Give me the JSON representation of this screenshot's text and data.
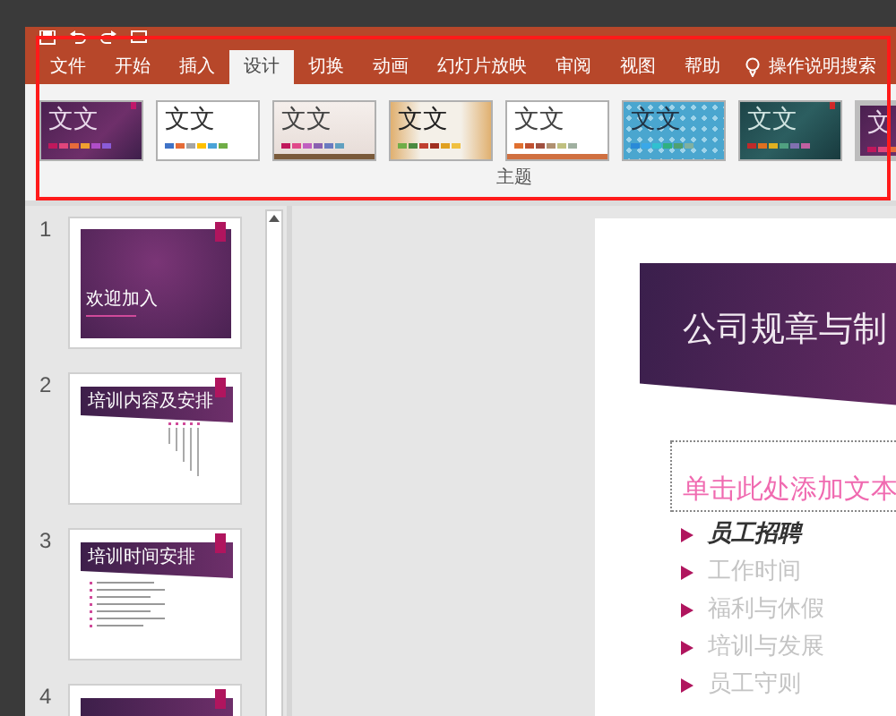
{
  "ribbon_tabs": [
    {
      "label": "文件",
      "selected": false
    },
    {
      "label": "开始",
      "selected": false
    },
    {
      "label": "插入",
      "selected": false
    },
    {
      "label": "设计",
      "selected": true
    },
    {
      "label": "切换",
      "selected": false
    },
    {
      "label": "动画",
      "selected": false
    },
    {
      "label": "幻灯片放映",
      "selected": false
    },
    {
      "label": "审阅",
      "selected": false
    },
    {
      "label": "视图",
      "selected": false
    },
    {
      "label": "帮助",
      "selected": false
    }
  ],
  "tell_me": {
    "label": "操作说明搜索"
  },
  "themes": [
    {
      "kind": "purple",
      "label": "文文",
      "selected": false
    },
    {
      "kind": "plain",
      "label": "文文",
      "selected": false
    },
    {
      "kind": "beige",
      "label": "文文",
      "selected": false
    },
    {
      "kind": "wood",
      "label": "文文",
      "selected": false
    },
    {
      "kind": "line",
      "label": "文文",
      "selected": false
    },
    {
      "kind": "pattern",
      "label": "文文",
      "selected": false
    },
    {
      "kind": "teal",
      "label": "文文",
      "selected": false
    },
    {
      "kind": "purple",
      "label": "文",
      "selected": true
    }
  ],
  "theme_group_label": "主题",
  "slides": [
    {
      "number": "1",
      "kind": "title",
      "title": "欢迎加入"
    },
    {
      "number": "2",
      "kind": "columns",
      "title": "培训内容及安排"
    },
    {
      "number": "3",
      "kind": "list",
      "title": "培训时间安排"
    },
    {
      "number": "4",
      "kind": "banner"
    }
  ],
  "slide": {
    "title": "公司规章与制",
    "placeholder": "单击此处添加文本",
    "bullets": [
      {
        "text": "员工招聘",
        "dimmed": false
      },
      {
        "text": "工作时间",
        "dimmed": true
      },
      {
        "text": "福利与休假",
        "dimmed": true
      },
      {
        "text": "培训与发展",
        "dimmed": true
      },
      {
        "text": "员工守则",
        "dimmed": true
      }
    ]
  }
}
